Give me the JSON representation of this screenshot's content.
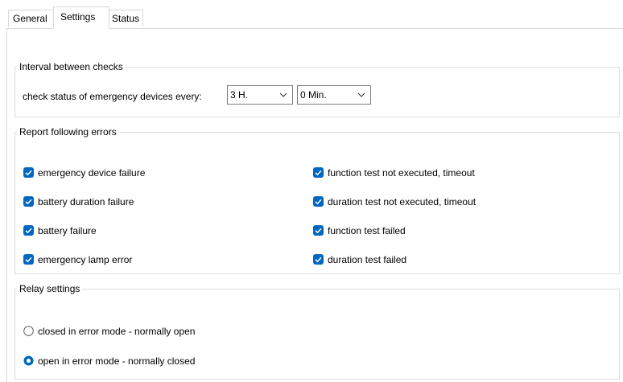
{
  "tabs": [
    {
      "label": "General",
      "active": false
    },
    {
      "label": "Settings",
      "active": true
    },
    {
      "label": "Status",
      "active": false
    }
  ],
  "interval": {
    "legend": "Interval between checks",
    "label": "check status of emergency devices every:",
    "hours_value": "3 H.",
    "minutes_value": "0 Min."
  },
  "errors": {
    "legend": "Report following errors",
    "items": [
      {
        "label": "emergency device failure",
        "checked": true
      },
      {
        "label": "battery duration failure",
        "checked": true
      },
      {
        "label": "battery failure",
        "checked": true
      },
      {
        "label": "emergency lamp error",
        "checked": true
      },
      {
        "label": "function test not executed, timeout",
        "checked": true
      },
      {
        "label": "duration test not executed, timeout",
        "checked": true
      },
      {
        "label": "function test failed",
        "checked": true
      },
      {
        "label": "duration test failed",
        "checked": true
      }
    ]
  },
  "relay": {
    "legend": "Relay settings",
    "options": [
      {
        "label": "closed in error mode - normally open",
        "selected": false
      },
      {
        "label": "open in error mode - normally closed",
        "selected": true
      }
    ]
  },
  "colors": {
    "accent": "#0067c0",
    "border": "#dcdcdc"
  }
}
